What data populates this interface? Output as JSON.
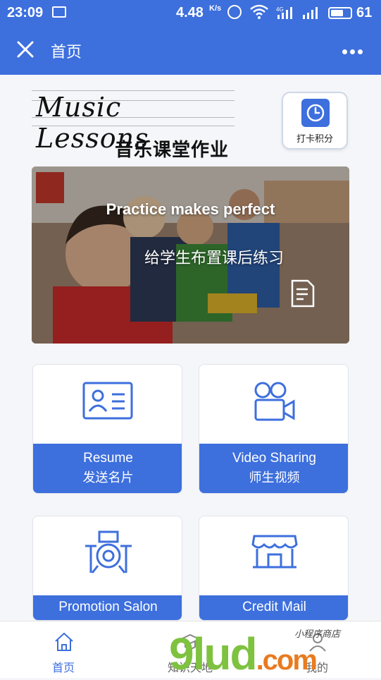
{
  "statusbar": {
    "time": "23:09",
    "speed": "4.48",
    "speed_unit": "K/s",
    "network": "4G",
    "battery": "61"
  },
  "navbar": {
    "title": "首页"
  },
  "header": {
    "logo_en": "Music Lessons",
    "logo_cn": "音乐课堂作业",
    "checkin_label": "打卡积分"
  },
  "banner": {
    "headline": "Practice makes perfect",
    "subtitle": "给学生布置课后练习"
  },
  "cards": [
    {
      "en": "Resume",
      "cn": "发送名片",
      "icon": "id-card-icon"
    },
    {
      "en": "Video Sharing",
      "cn": "师生视频",
      "icon": "video-camera-icon"
    },
    {
      "en": "Promotion Salon",
      "icon": "drum-kit-icon"
    },
    {
      "en": "Credit Mail",
      "icon": "store-icon"
    }
  ],
  "tabbar": {
    "items": [
      {
        "label": "首页",
        "active": true
      },
      {
        "label": "知识天地",
        "active": false
      },
      {
        "label": "我的",
        "active": false
      }
    ]
  },
  "watermark": {
    "main": "9lud",
    "suffix": ".com",
    "sub": "小程序商店"
  },
  "colors": {
    "accent": "#3d6fdd",
    "active_tab": "#3d6fdd",
    "inactive_tab": "#666666"
  }
}
